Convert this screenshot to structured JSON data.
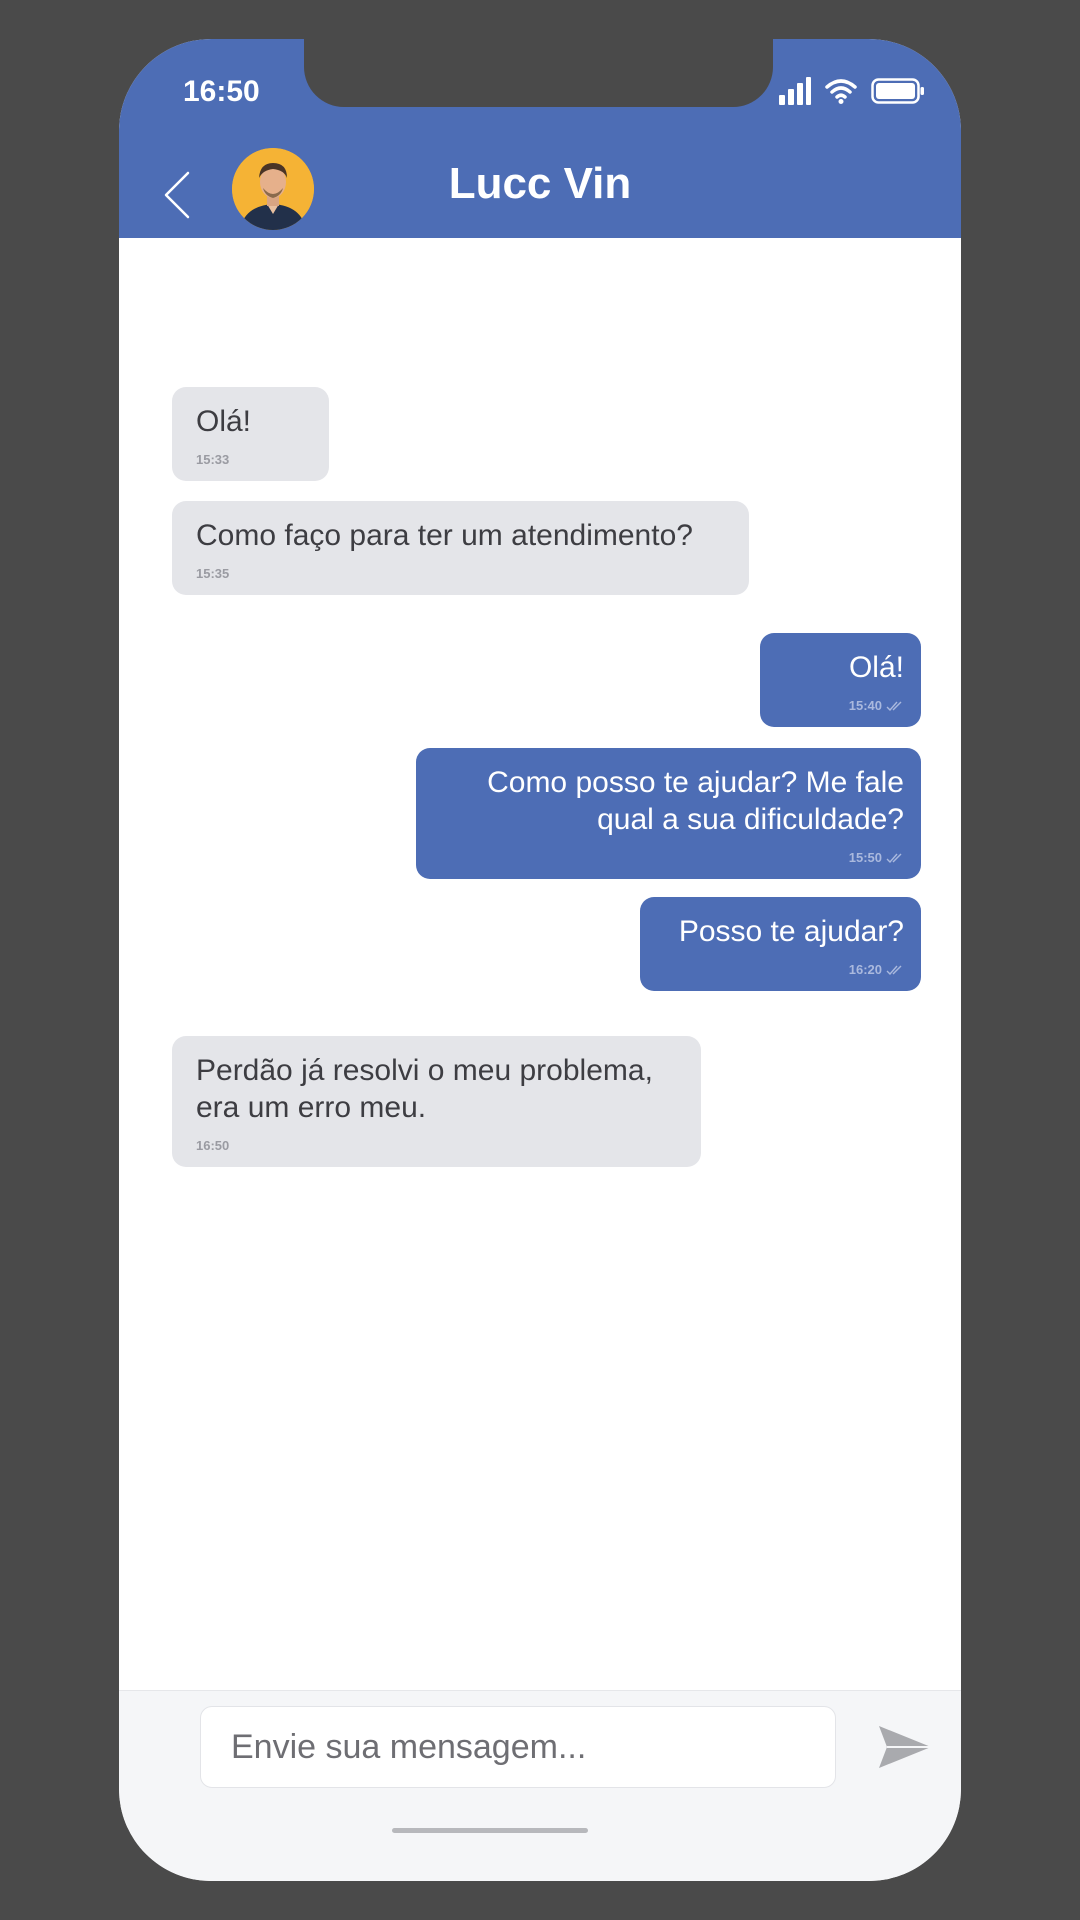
{
  "status_bar": {
    "time": "16:50",
    "icons": [
      "signal-icon",
      "wifi-icon",
      "battery-icon"
    ]
  },
  "header": {
    "contact_name": "Lucc Vin",
    "back_icon": "chevron-left-icon",
    "avatar": "avatar"
  },
  "messages": [
    {
      "direction": "in",
      "text": "Olá!",
      "time": "15:33"
    },
    {
      "direction": "in",
      "text": "Como faço para ter um atendimento?",
      "time": "15:35"
    },
    {
      "direction": "out",
      "text": "Olá!",
      "time": "15:40",
      "read_icon": "double-check-icon"
    },
    {
      "direction": "out",
      "text": "Como posso te ajudar? Me fale qual a sua dificuldade?",
      "time": "15:50",
      "read_icon": "double-check-icon"
    },
    {
      "direction": "out",
      "text": "Posso te ajudar?",
      "time": "16:20",
      "read_icon": "double-check-icon"
    },
    {
      "direction": "in",
      "text": "Perdão já resolvi o meu problema, era um erro meu.",
      "time": "16:50"
    }
  ],
  "composer": {
    "placeholder": "Envie sua mensagem...",
    "send_icon": "send-icon"
  },
  "colors": {
    "accent": "#4d6db5",
    "incoming_bubble": "#e4e5e9",
    "background": "#4a4a4a",
    "avatar_bg": "#f5b335"
  }
}
